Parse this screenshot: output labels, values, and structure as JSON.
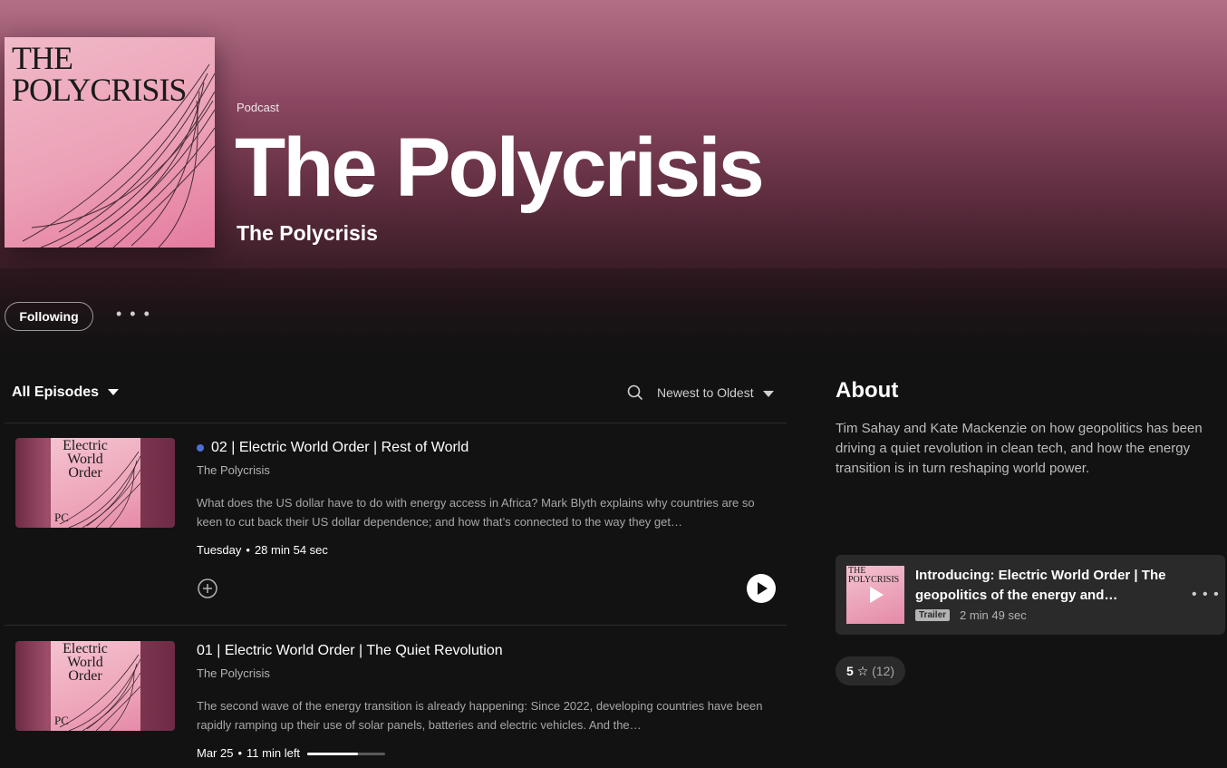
{
  "podcast": {
    "kind": "Podcast",
    "title": "The Polycrisis",
    "publisher": "The Polycrisis",
    "cover_text": "THE POLYCRISIS",
    "cover_icon": "podcast-cover-art"
  },
  "actions": {
    "follow_label": "Following",
    "more_label": "• • •"
  },
  "episodes_header": {
    "filter_label": "All Episodes",
    "sort_label": "Newest to Oldest"
  },
  "episodes": [
    {
      "title": "02 | Electric World Order | Rest of World",
      "show": "The Polycrisis",
      "description": "What does the US dollar have to do with energy access in Africa? Mark Blyth explains why countries are so keen to cut back their US dollar dependence; and how that’s connected to the way they get…",
      "date": "Tuesday",
      "duration": "28 min 54 sec",
      "thumb_text": "Electric World Order",
      "thumb_mark": "PC",
      "unplayed": true
    },
    {
      "title": "01 | Electric World Order | The Quiet Revolution",
      "show": "The Polycrisis",
      "description": "The second wave of the energy transition is already happening: Since 2022, developing countries have been rapidly ramping up their use of solar panels, batteries and electric vehicles. And the…",
      "date": "Mar 25",
      "duration": "11 min left",
      "progress": 0.65,
      "thumb_text": "Electric World Order",
      "thumb_mark": "PC"
    }
  ],
  "about": {
    "heading": "About",
    "text": "Tim Sahay and Kate Mackenzie on  how geopolitics has been driving a quiet revolution in clean tech, and how the energy transition is in turn reshaping world power."
  },
  "trailer": {
    "title": "Introducing: Electric World Order | The geopolitics of the energy and…",
    "badge": "Trailer",
    "duration": "2 min 49 sec",
    "thumb_text": "THE POLYCRISIS"
  },
  "rating": {
    "score": "5",
    "count": "(12)"
  },
  "colors": {
    "hero_top": "#b26f85",
    "hero_mid": "#5a2b3c",
    "background": "#121212",
    "unplayed_dot": "#4f6fd6",
    "cover_pink": "#eca1b7"
  }
}
